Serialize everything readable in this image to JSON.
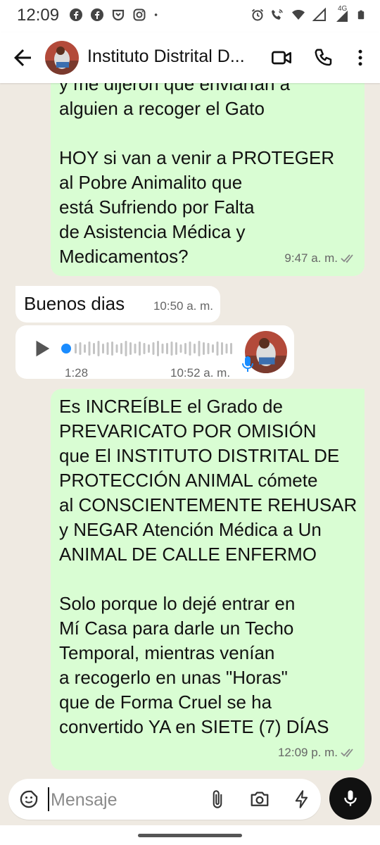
{
  "status_bar": {
    "time": "12:09",
    "left_icons": [
      "facebook-icon",
      "facebook-icon",
      "pocket-icon",
      "instagram-icon",
      "dot-icon"
    ],
    "right_icons": [
      "alarm-icon",
      "wifi-calling-icon",
      "wifi-icon",
      "signal-icon",
      "signal-4g-icon",
      "battery-icon"
    ],
    "network": "4G"
  },
  "header": {
    "title": "Instituto Distrital D...",
    "icons": [
      "back-arrow-icon",
      "video-call-icon",
      "phone-icon",
      "more-vert-icon"
    ]
  },
  "messages": [
    {
      "direction": "outgoing",
      "text": "y me dijeron que enviarían a\nalguien a recoger el Gato\n\nHOY si van a venir a PROTEGER\nal Pobre Animalito que\nestá Sufriendo por Falta\nde Asistencia Médica y\nMedicamentos?",
      "time": "9:47 a. m.",
      "status": "read"
    },
    {
      "direction": "incoming",
      "text": "Buenos dias",
      "time": "10:50 a. m."
    },
    {
      "direction": "incoming",
      "type": "voice",
      "duration": "1:28",
      "time": "10:52 a. m."
    },
    {
      "direction": "outgoing",
      "text": "Es INCREÍBLE el Grado de\nPREVARICATO POR OMISIÓN\nque El INSTITUTO DISTRITAL DE\nPROTECCIÓN ANIMAL cómete\nal CONSCIENTEMENTE REHUSAR\ny NEGAR Atención Médica a Un\nANIMAL DE CALLE ENFERMO\n\nSolo porque lo dejé entrar en\nMí Casa para darle un Techo\nTemporal, mientras  venían\na recogerlo en unas \"Horas\"\nque de Forma Cruel se ha\nconvertido YA en SIETE (7) DÍAS",
      "time": "12:09 p. m.",
      "status": "read"
    }
  ],
  "composer": {
    "placeholder": "Mensaje",
    "icons": [
      "sticker-icon",
      "attach-icon",
      "camera-icon",
      "bolt-icon",
      "mic-icon"
    ]
  },
  "colors": {
    "chat_bg": "#efeae2",
    "outgoing_bubble": "#d9fdd3",
    "incoming_bubble": "#ffffff",
    "read_ticks": "#8a8a8a"
  }
}
